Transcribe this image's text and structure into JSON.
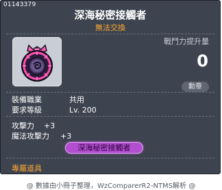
{
  "item": {
    "id": "01143379",
    "name": "深海秘密接觸者",
    "trade_status": "無法交換",
    "combat_power_label": "戰鬥力提升量",
    "combat_power_value": "0",
    "medal_badge": "勳章",
    "icon": "deep-sea-medal-icon"
  },
  "requirements": [
    {
      "label": "裝備職業",
      "value": "共用"
    },
    {
      "label": "要求等級",
      "value": "Lv. 200"
    }
  ],
  "stats": [
    {
      "label": "攻擊力",
      "value": "+3"
    },
    {
      "label": "魔法攻擊力",
      "value": "+3"
    }
  ],
  "set_label": "深海秘密接觸者",
  "exclusive_label": "專屬道具",
  "footer": "@ 數據由小冊子整理，WzComparerR2-NTMS解析 @",
  "colors": {
    "tooltip_bg": "#3d434f",
    "accent_orange": "#ffaa33",
    "set_purple": "#b24fd0"
  }
}
